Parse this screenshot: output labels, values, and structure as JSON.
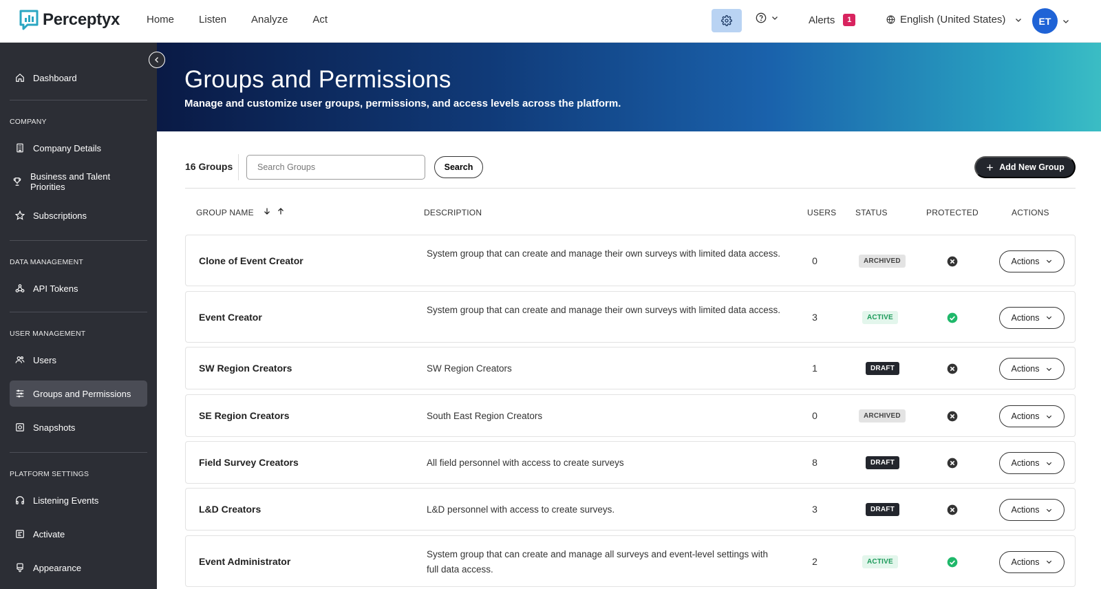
{
  "app": {
    "brand": "Perceptyx"
  },
  "topnav": {
    "items": [
      "Home",
      "Listen",
      "Analyze",
      "Act"
    ],
    "alerts_label": "Alerts",
    "alerts_count": "1",
    "language": "English (United States)",
    "avatar_initials": "ET"
  },
  "sidebar": {
    "dashboard": "Dashboard",
    "sections": {
      "company": "COMPANY",
      "data_management": "DATA MANAGEMENT",
      "user_management": "USER MANAGEMENT",
      "platform_settings": "PLATFORM SETTINGS"
    },
    "items": {
      "company_details": "Company Details",
      "business_priorities": "Business and Talent Priorities",
      "subscriptions": "Subscriptions",
      "api_tokens": "API Tokens",
      "users": "Users",
      "groups_permissions": "Groups and Permissions",
      "snapshots": "Snapshots",
      "listening_events": "Listening Events",
      "activate": "Activate",
      "appearance": "Appearance"
    },
    "active_item": "Groups and Permissions"
  },
  "hero": {
    "title": "Groups and Permissions",
    "subtitle": "Manage and customize user groups, permissions, and access levels across the platform."
  },
  "toolbar": {
    "groups_count": "16 Groups",
    "search_placeholder": "Search Groups",
    "search_label": "Search",
    "add_label": "Add New Group"
  },
  "table": {
    "headers": {
      "name": "GROUP NAME",
      "description": "DESCRIPTION",
      "users": "USERS",
      "status": "STATUS",
      "protected": "PROTECTED",
      "actions": "ACTIONS"
    },
    "actions_label": "Actions",
    "rows": [
      {
        "name": "Clone of Event Creator",
        "description": "System group that can create and manage their own surveys with limited data access.",
        "users": "0",
        "status": "ARCHIVED",
        "protected": false
      },
      {
        "name": "Event Creator",
        "description": "System group that can create and manage their own surveys with limited data access.",
        "users": "3",
        "status": "ACTIVE",
        "protected": true
      },
      {
        "name": "SW Region Creators",
        "description": "SW Region Creators",
        "users": "1",
        "status": "DRAFT",
        "protected": false
      },
      {
        "name": "SE Region Creators",
        "description": "South East Region Creators",
        "users": "0",
        "status": "ARCHIVED",
        "protected": false
      },
      {
        "name": "Field Survey Creators",
        "description": "All field personnel with access to create surveys",
        "users": "8",
        "status": "DRAFT",
        "protected": false
      },
      {
        "name": "L&D Creators",
        "description": "L&D personnel with access to create surveys.",
        "users": "3",
        "status": "DRAFT",
        "protected": false
      },
      {
        "name": "Event Administrator",
        "description": "System group that can create and manage all surveys and event-level settings with full data access.",
        "users": "2",
        "status": "ACTIVE",
        "protected": true
      }
    ]
  },
  "colors": {
    "sidebar_bg": "#2c2e35",
    "accent_blue": "#1f63d6",
    "alert_badge": "#d8245f",
    "active_green": "#1fb86a",
    "protected_no": "#333333"
  }
}
